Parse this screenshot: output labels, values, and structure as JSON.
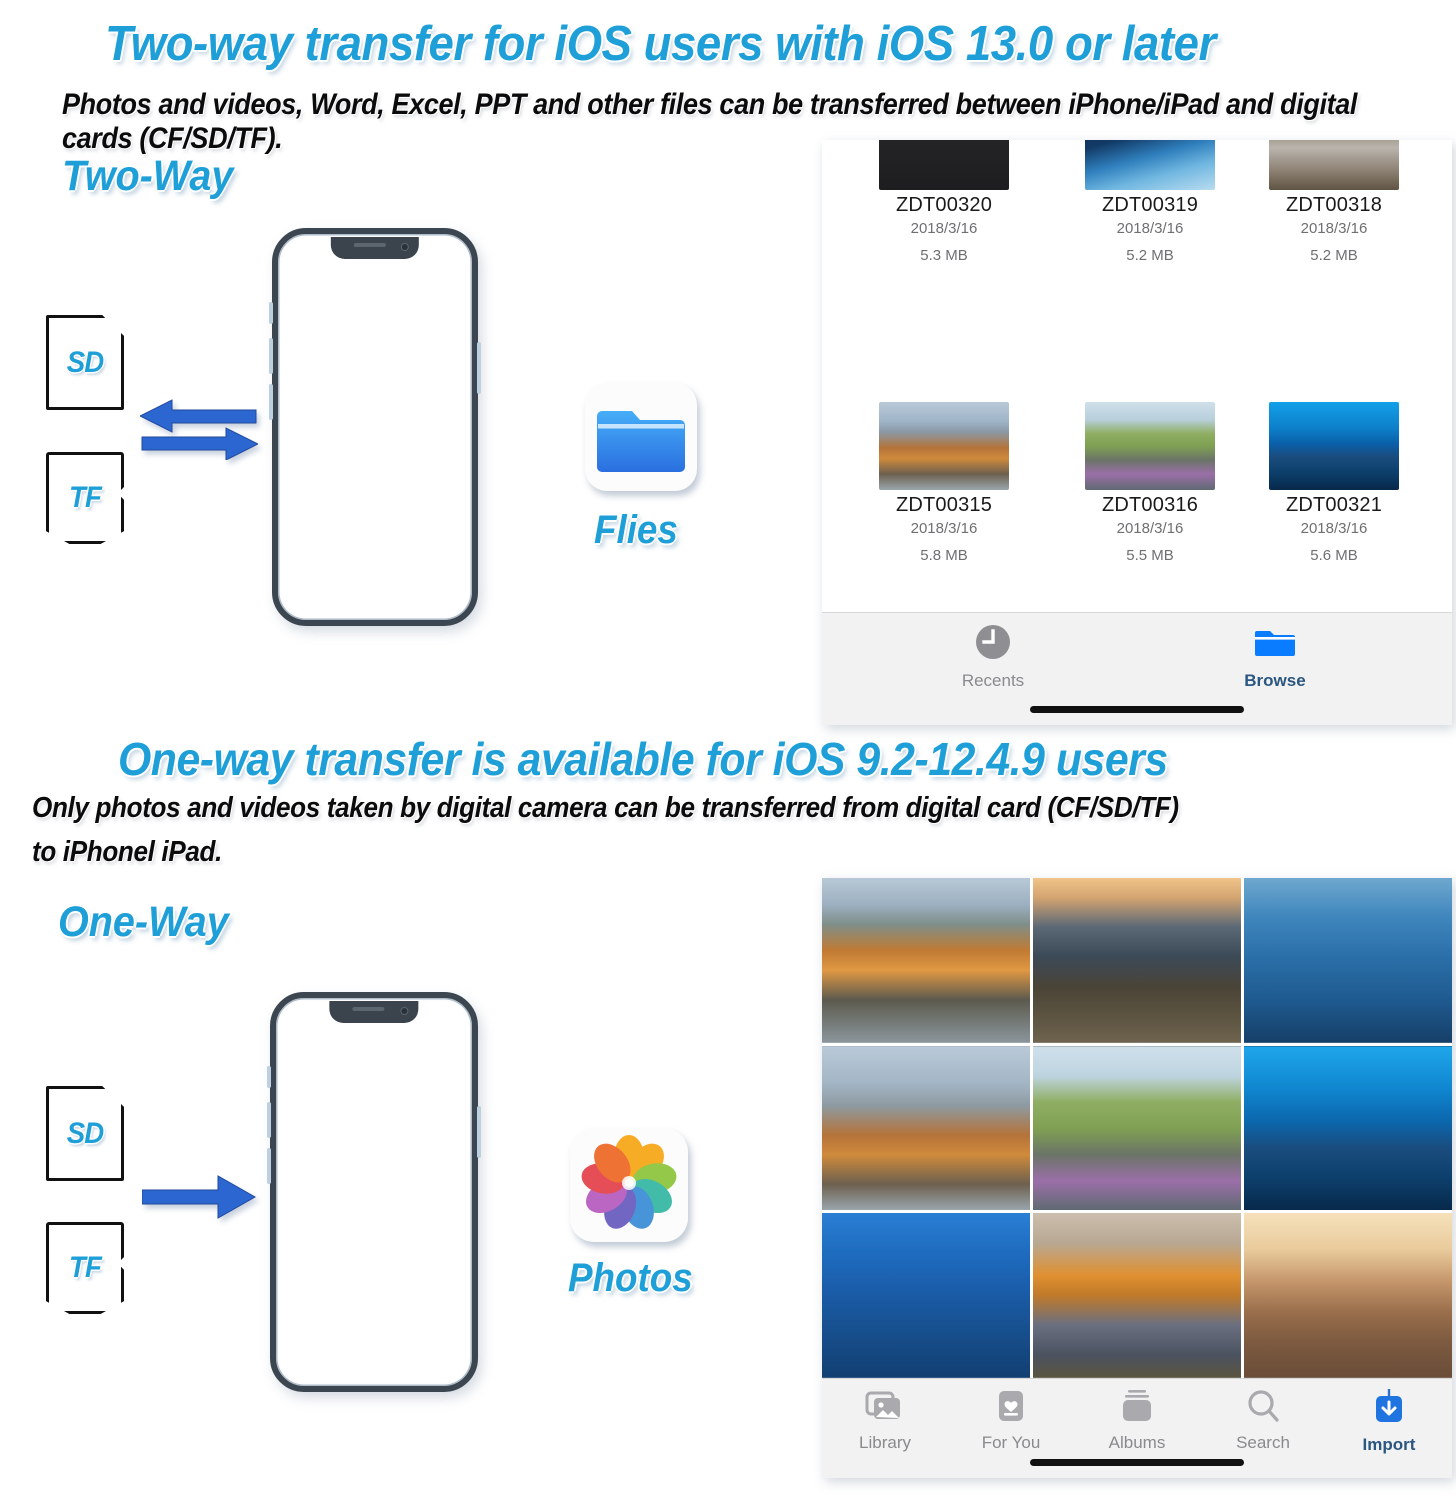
{
  "headings": {
    "two_way_title": "Two-way transfer for iOS users with iOS 13.0 or later",
    "two_way_sub": "Photos and videos, Word, Excel, PPT and other files can be transferred between iPhone/iPad and digital cards (CF/SD/TF).",
    "one_way_title": "One-way transfer is available for iOS 9.2-12.4.9 users",
    "one_way_sub_line1": "Only photos and videos taken by digital camera can be transferred from digital card (CF/SD/TF)",
    "one_way_sub_line2": "to iPhonel iPad."
  },
  "two_way_section": {
    "tag": "Two-Way",
    "card_sd": "SD",
    "card_tf": "TF",
    "arrow": "double-arrow-left-right",
    "app_label": "Flies",
    "app_icon": "files-folder-icon"
  },
  "one_way_section": {
    "tag": "One-Way",
    "card_sd": "SD",
    "card_tf": "TF",
    "arrow": "single-arrow-right",
    "app_label": "Photos",
    "app_icon": "photos-flower-icon"
  },
  "files_app": {
    "items": [
      {
        "name": "ZDT00320",
        "date": "2018/3/16",
        "size": "5.3 MB"
      },
      {
        "name": "ZDT00319",
        "date": "2018/3/16",
        "size": "5.2 MB"
      },
      {
        "name": "ZDT00318",
        "date": "2018/3/16",
        "size": "5.2 MB"
      },
      {
        "name": "ZDT00315",
        "date": "2018/3/16",
        "size": "5.8 MB"
      },
      {
        "name": "ZDT00316",
        "date": "2018/3/16",
        "size": "5.5 MB"
      },
      {
        "name": "ZDT00321",
        "date": "2018/3/16",
        "size": "5.6 MB"
      }
    ],
    "tabs": [
      {
        "label": "Recents",
        "icon": "clock-icon",
        "active": false
      },
      {
        "label": "Browse",
        "icon": "folder-icon",
        "active": true
      }
    ]
  },
  "photos_app": {
    "tabs": [
      {
        "label": "Library",
        "icon": "photo-stack-icon",
        "active": false
      },
      {
        "label": "For You",
        "icon": "heart-card-icon",
        "active": false
      },
      {
        "label": "Albums",
        "icon": "albums-icon",
        "active": false
      },
      {
        "label": "Search",
        "icon": "search-icon",
        "active": false
      },
      {
        "label": "Import",
        "icon": "import-download-icon",
        "active": true
      }
    ],
    "photo_count": 9
  },
  "colors": {
    "accent_cyan": "#1F9FD8",
    "arrow_blue": "#2C66D0",
    "ios_blue": "#0A7CFF",
    "tab_inactive": "#8a8a8e",
    "tab_active": "#2a5680"
  }
}
